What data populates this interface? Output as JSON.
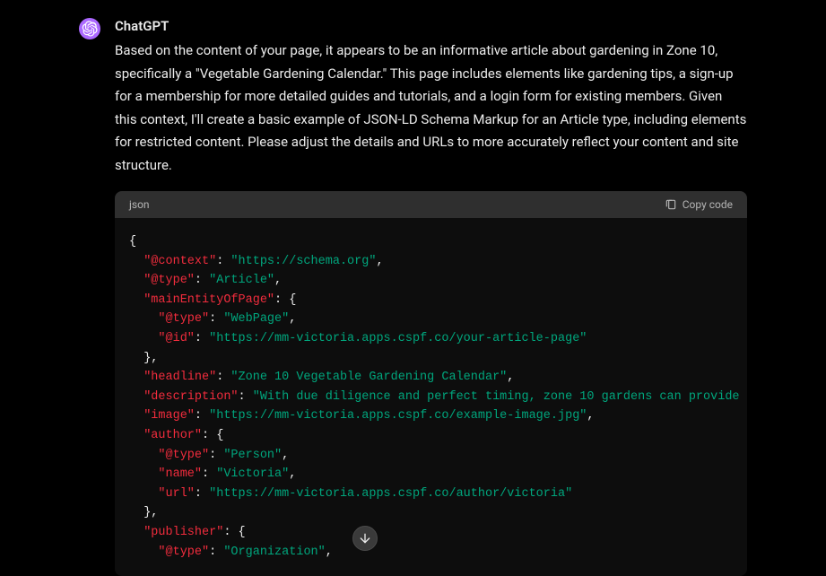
{
  "author": "ChatGPT",
  "body": "Based on the content of your page, it appears to be an informative article about gardening in Zone 10, specifically a \"Vegetable Gardening Calendar.\" This page includes elements like gardening tips, a sign-up for a membership for more detailed guides and tutorials, and a login form for existing members. Given this context, I'll create a basic example of JSON-LD Schema Markup for an Article type, including elements for restricted content. Please adjust the details and URLs to more accurately reflect your content and site structure.",
  "code_header": {
    "lang": "json",
    "copy_label": "Copy code"
  },
  "code": {
    "t": [
      "{",
      "  ",
      "\"@context\"",
      ": ",
      "\"https://schema.org\"",
      ",",
      "  ",
      "\"@type\"",
      ": ",
      "\"Article\"",
      ",",
      "  ",
      "\"mainEntityOfPage\"",
      ": {",
      "    ",
      "\"@type\"",
      ": ",
      "\"WebPage\"",
      ",",
      "    ",
      "\"@id\"",
      ": ",
      "\"https://mm-victoria.apps.cspf.co/your-article-page\"",
      "  },",
      "  ",
      "\"headline\"",
      ": ",
      "\"Zone 10 Vegetable Gardening Calendar\"",
      ",",
      "  ",
      "\"description\"",
      ": ",
      "\"With due diligence and perfect timing, zone 10 gardens can provide",
      "  ",
      "\"image\"",
      ": ",
      "\"https://mm-victoria.apps.cspf.co/example-image.jpg\"",
      ",",
      "  ",
      "\"author\"",
      ": {",
      "    ",
      "\"@type\"",
      ": ",
      "\"Person\"",
      ",",
      "    ",
      "\"name\"",
      ": ",
      "\"Victoria\"",
      ",",
      "    ",
      "\"url\"",
      ": ",
      "\"https://mm-victoria.apps.cspf.co/author/victoria\"",
      "  },",
      "  ",
      "\"publisher\"",
      ": {",
      "    ",
      "\"@type\"",
      ": ",
      "\"Organization\"",
      ","
    ]
  }
}
